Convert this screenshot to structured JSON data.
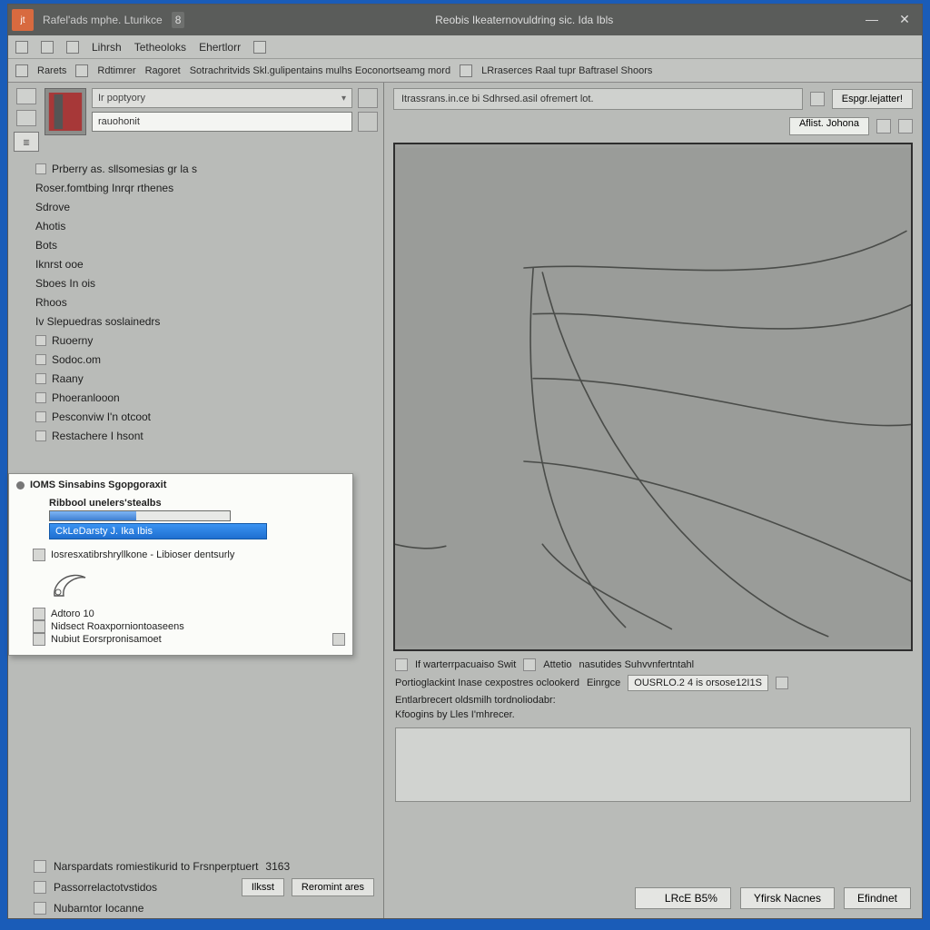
{
  "titlebar": {
    "app_abbrev": "jt",
    "segment_a": "Rafel'ads mphe. Lturikce",
    "badge": "8",
    "center": "Reobis Ikeaternovuldring sic. Ida Ibls"
  },
  "menubar": {
    "items": [
      "Lihrsh",
      "Tetheoloks",
      "Ehertlorr"
    ]
  },
  "ribbon": {
    "items": [
      "Rarets",
      "Rdtimrer",
      "Ragoret",
      "Sotrachritvids Skl.gulipentains mulhs Eoconortseamg mord",
      "LRraserces Raal tupr Baftrasel Shoors"
    ]
  },
  "left": {
    "combo_value": "Ir poptyory",
    "search_value": "rauohonit",
    "tree": [
      "Prberry as. sllsomesias gr la s",
      "Roser.fomtbing Inrqr rthenes",
      "Sdrove",
      "Ahotis",
      "Bots",
      "Iknrst ooe",
      "Sboes In ois",
      "Rhoos",
      "Iv Slepuedras soslainedrs",
      "Ruoerny",
      "Sodoc.om",
      "Raany",
      "Phoeranlooon",
      "Pesconviw I'n otcoot",
      "Restachere I hsont"
    ],
    "bottom": {
      "row1_label": "Narspardats romiestikurid to Frsnperptuert",
      "row1_value": "3163",
      "btn_a": "Ilksst",
      "btn_b": "Reromint ares",
      "row2_label": "Passorrelactotvstidos",
      "row3_label": "Nubarntor Iocanne"
    }
  },
  "popup": {
    "header": "IOMS Sinsabins Sgopgoraxit",
    "node_a": "Ribbool unelers'stealbs",
    "highlight": "CkLeDarsty  J. Ika Ibis",
    "node_b": "Iosresxatibrshryllkone - Libioser dentsurly",
    "opt1": "Adtoro 10",
    "opt2": "Nidsect Roaxporniontoaseens",
    "opt3": "Nubiut Eorsrpronisamoet"
  },
  "right": {
    "breadcrumb": "Itrassrans.in.ce bi Sdhrsed.asil ofremert lot.",
    "tag_btn": "Espgr.lejatter!",
    "tab_label": "Aflist. Johona",
    "meta": {
      "bar_a": "If warterrpacuaiso Swit",
      "bar_b": "Attetio",
      "bar_c": "nasutides Suhvvnfertntahl",
      "line2_a": "Portioglackint Inase cexpostres oclookerd",
      "line2_b": "Einrgce",
      "line2_val": "OUSRLO.2 4 is orsose12I1S",
      "line3": "Entlarbrecert oldsmilh tordnoliodabr:",
      "line4": "Kfoogins by Lles I'mhrecer."
    }
  },
  "footer": {
    "btn1": "LRcE B5%",
    "btn2": "Yfirsk Nacnes",
    "btn3": "Efindnet"
  }
}
